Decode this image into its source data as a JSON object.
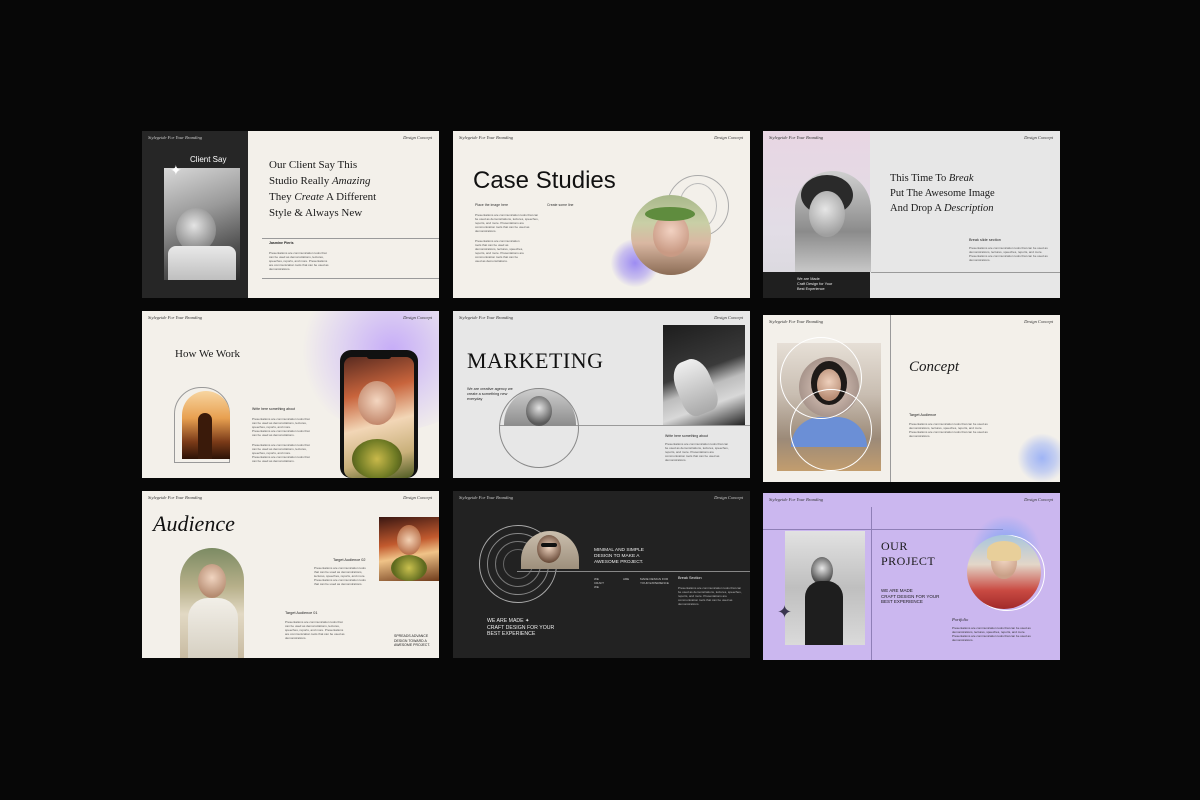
{
  "header": "Stylegeide For Your Branding",
  "concept_tag": "Design Concept",
  "lorem": "Presentations are communication tools that can be used as demonstrations, lectures, speeches, reports, and more. Presentations are communication tools that can be used as demonstrations.",
  "slide1": {
    "photo_label": "Client Say",
    "heading_l1": "Our Client Say This",
    "heading_l2a": "Studio Really ",
    "heading_l2b": "Amazing",
    "heading_l3a": "They ",
    "heading_l3b": "Create",
    "heading_l3c": " A Different",
    "heading_l4": "Style & Always New",
    "sub": "Jasmine Pieris"
  },
  "slide2": {
    "title": "Case Studies",
    "label_a": "Place the image here",
    "label_b": "Create some line"
  },
  "slide3": {
    "heading_l1a": "This Time To ",
    "heading_l1b": "Break",
    "heading_l2": "Put The Awesome Image",
    "heading_l3a": "And Drop A ",
    "heading_l3b": "Description",
    "sub": "Break slide section",
    "caption_l1": "We are Made",
    "caption_l2": "Craft Design for Your",
    "caption_l3": "Best Experience"
  },
  "slide4": {
    "title": "How We Work",
    "sub": "Write here something about"
  },
  "slide5": {
    "title": "MARKETING",
    "side_text": "We are creative agency we create a something new everyday",
    "sub": "Write here something about"
  },
  "slide6": {
    "title": "Concept",
    "sub": "Target Audience"
  },
  "slide7": {
    "title": "Audience",
    "target2": "Target Audience 02",
    "target1": "Target Audience 01",
    "caption_l1": "SPREADS ADVANCE",
    "caption_l2": "DESIGN TOWARD A",
    "caption_l3": "AWESOME PROJECT."
  },
  "slide8": {
    "top_l1": "MINIMAL AND SIMPLE",
    "top_l2": "DESIGN TO MAKE A",
    "top_l3": "AWESOME PROJECT.",
    "col_a": "WE CRAFT WE",
    "col_b": "ARE",
    "col_c": "MADE DESIGN FOR YOUR EXPERIENCE",
    "sub": "Break Section",
    "bottom_l1": "WE ARE MADE",
    "bottom_l2": "CRAFT DESIGN FOR YOUR",
    "bottom_l3": "BEST EXPERIENCE"
  },
  "slide9": {
    "title_l1": "OUR",
    "title_l2": "PROJECT",
    "sub_l1": "WE ARE MADE",
    "sub_l2": "CRAFT DESIGN FOR YOUR",
    "sub_l3": "BEST EXPERIENCE",
    "portfolio": "Portfolio"
  },
  "colors": {
    "background": "#070707",
    "cream": "#f3f0ea",
    "dark": "#222222",
    "lavender": "#c9b6ee",
    "gray": "#e6e6e6"
  }
}
